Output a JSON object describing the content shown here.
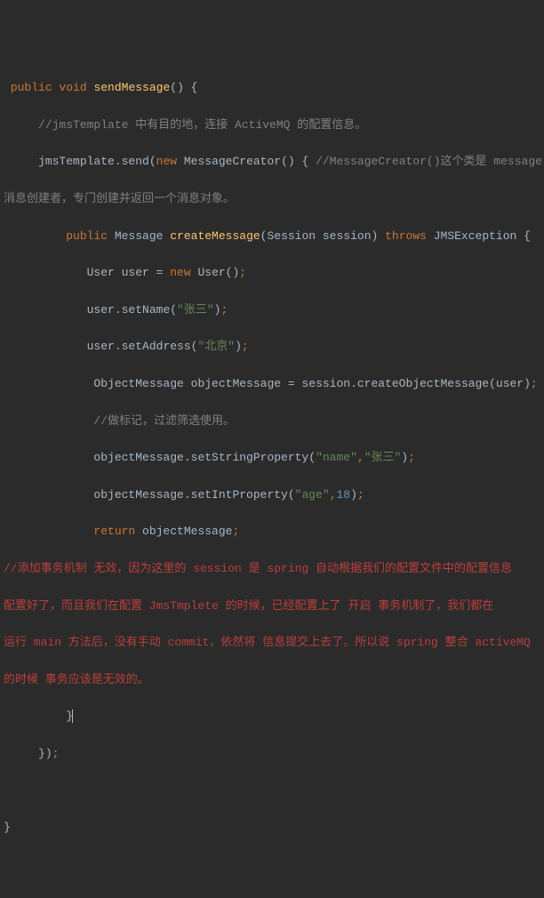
{
  "line1_p1": "public ",
  "line1_p2": "void ",
  "line1_p3": "sendMessage",
  "line1_p4": "() {",
  "line2": "//jmsTemplate 中有目的地，连接 ActiveMQ 的配置信息。",
  "line3_p1": "jmsTemplate.send(",
  "line3_p2": "new ",
  "line3_p3": "MessageCreator() { ",
  "line3_p4": "//MessageCreator()这个类是 message",
  "line4": "消息创建者，专门创建并返回一个消息对象。",
  "line5_p1": "public ",
  "line5_p2": "Message ",
  "line5_p3": "createMessage",
  "line5_p4": "(Session session) ",
  "line5_p5": "throws ",
  "line5_p6": "JMSException {",
  "line6_p1": "User user = ",
  "line6_p2": "new ",
  "line6_p3": "User()",
  "line6_p4": ";",
  "line7_p1": "user.setName(",
  "line7_p2": "\"张三\"",
  "line7_p3": ")",
  "line7_p4": ";",
  "line8_p1": "user.setAddress(",
  "line8_p2": "\"北京\"",
  "line8_p3": ")",
  "line8_p4": ";",
  "line9_p1": "ObjectMessage objectMessage = session.createObjectMessage(user)",
  "line9_p2": ";",
  "line10": "//做标记，过滤筛选使用。",
  "line11_p1": "objectMessage.setStringProperty(",
  "line11_p2": "\"name\"",
  "line11_p3": ",",
  "line11_p4": "\"张三\"",
  "line11_p5": ")",
  "line11_p6": ";",
  "line12_p1": "objectMessage.setIntProperty(",
  "line12_p2": "\"age\"",
  "line12_p3": ",",
  "line12_p4": "18",
  "line12_p5": ")",
  "line12_p6": ";",
  "line13_p1": "return ",
  "line13_p2": "objectMessage",
  "line13_p3": ";",
  "line14": "//添加事务机制 无效，因为这里的 session 是 spring 自动根据我们的配置文件中的配置信息",
  "line15": "配置好了，而且我们在配置 JmsTmplete 的时候，已经配置上了 开启 事务机制了，我们都在",
  "line16": "运行 main 方法后，没有手动 commit，依然将 信息提交上去了。所以说 spring 整合 activeMQ",
  "line17": "的时候 事务应该是无效的。",
  "line18": "}",
  "line19_p1": "})",
  "line19_p2": ";",
  "line20": "}"
}
